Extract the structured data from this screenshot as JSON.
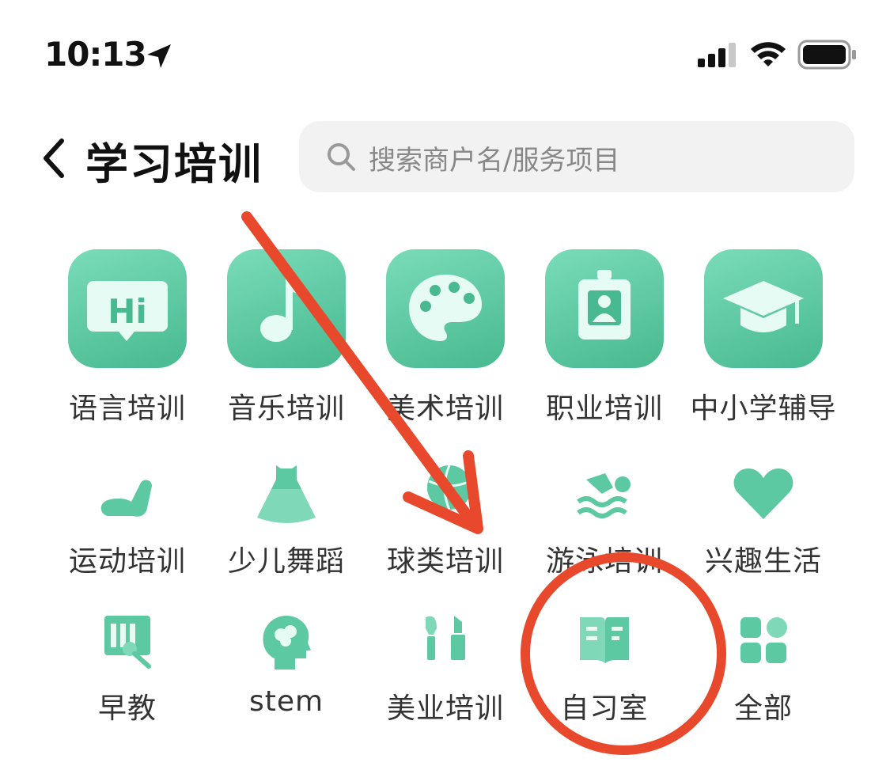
{
  "status": {
    "time": "10:13"
  },
  "header": {
    "title": "学习培训",
    "search_placeholder": "搜索商户名/服务项目"
  },
  "categories": [
    {
      "label": "语言培训",
      "icon": "hi-speech-bubble-icon"
    },
    {
      "label": "音乐培训",
      "icon": "music-note-icon"
    },
    {
      "label": "美术培训",
      "icon": "palette-icon"
    },
    {
      "label": "职业培训",
      "icon": "id-badge-icon"
    },
    {
      "label": "中小学辅导",
      "icon": "graduation-cap-icon"
    },
    {
      "label": "运动培训",
      "icon": "flexed-arm-icon"
    },
    {
      "label": "少儿舞蹈",
      "icon": "dress-icon"
    },
    {
      "label": "球类培训",
      "icon": "ball-icon"
    },
    {
      "label": "游泳培训",
      "icon": "swimmer-icon"
    },
    {
      "label": "兴趣生活",
      "icon": "heart-icon"
    },
    {
      "label": "早教",
      "icon": "toy-icon"
    },
    {
      "label": "stem",
      "icon": "brain-head-icon"
    },
    {
      "label": "美业培训",
      "icon": "makeup-icon"
    },
    {
      "label": "自习室",
      "icon": "open-book-icon"
    },
    {
      "label": "全部",
      "icon": "grid-all-icon"
    }
  ],
  "colors": {
    "accent": "#5cc9a2",
    "annotation": "#e8492c"
  }
}
